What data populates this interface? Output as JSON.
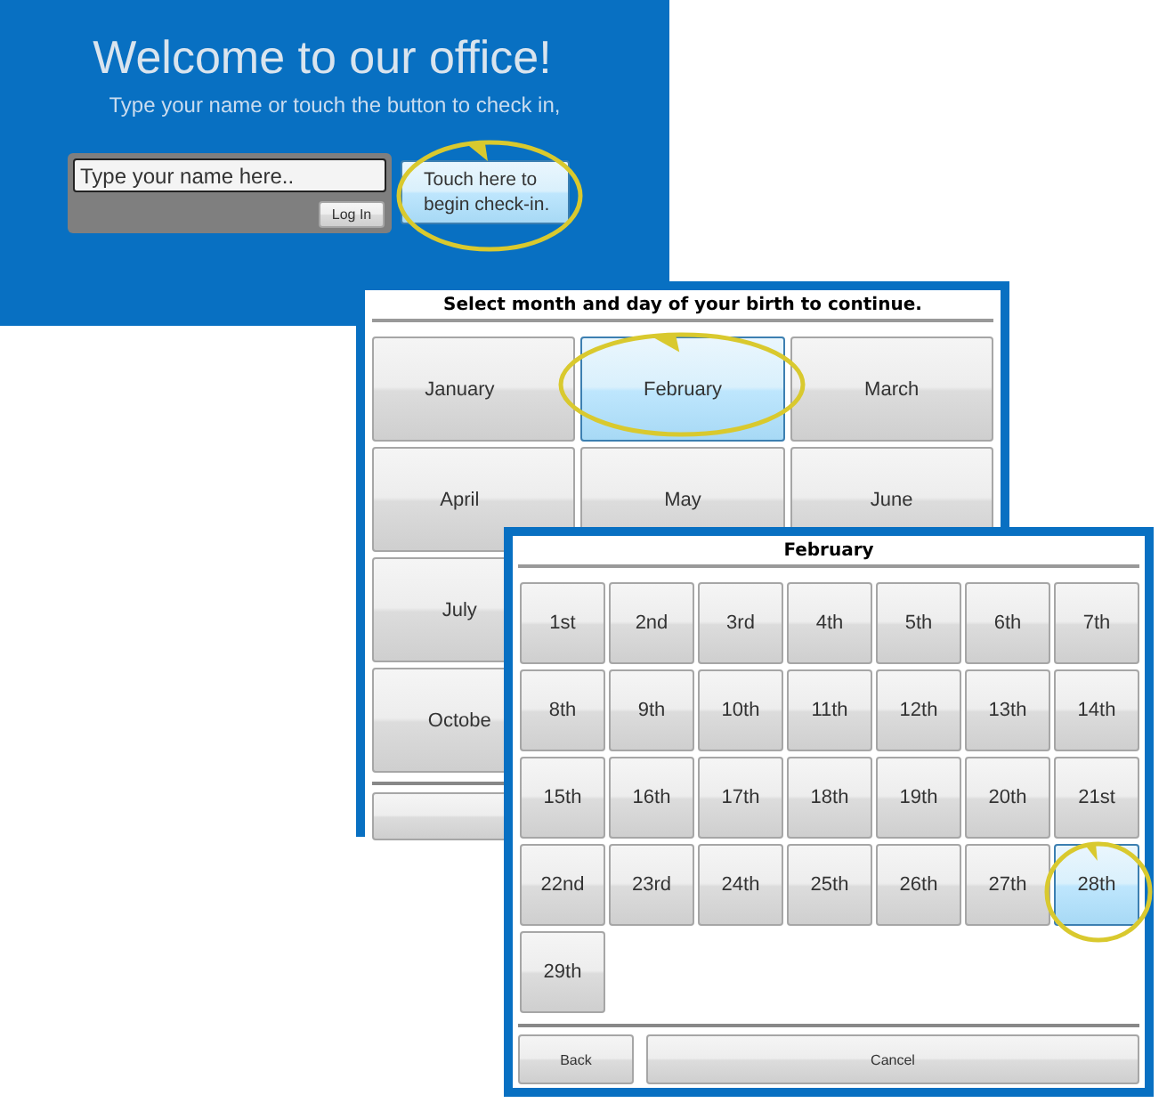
{
  "welcome": {
    "title": "Welcome to our office!",
    "subtitle": "Type your name or touch the button to check in,",
    "name_field": {
      "placeholder": "Type your name here.."
    },
    "login_button": "Log In",
    "checkin_button": "Touch here to begin check-in."
  },
  "month_dialog": {
    "title": "Select month and day of your birth to continue.",
    "rows": [
      [
        {
          "label": "January",
          "selected": false
        },
        {
          "label": "February",
          "selected": true
        },
        {
          "label": "March",
          "selected": false
        }
      ],
      [
        {
          "label": "April",
          "selected": false
        },
        {
          "label": "May",
          "selected": false
        },
        {
          "label": "June",
          "selected": false
        }
      ],
      [
        {
          "label": "July",
          "selected": false
        }
      ],
      [
        {
          "label": "Octobe",
          "selected": false
        }
      ]
    ]
  },
  "day_dialog": {
    "title": "February",
    "days": [
      {
        "label": "1st",
        "selected": false
      },
      {
        "label": "2nd",
        "selected": false
      },
      {
        "label": "3rd",
        "selected": false
      },
      {
        "label": "4th",
        "selected": false
      },
      {
        "label": "5th",
        "selected": false
      },
      {
        "label": "6th",
        "selected": false
      },
      {
        "label": "7th",
        "selected": false
      },
      {
        "label": "8th",
        "selected": false
      },
      {
        "label": "9th",
        "selected": false
      },
      {
        "label": "10th",
        "selected": false
      },
      {
        "label": "11th",
        "selected": false
      },
      {
        "label": "12th",
        "selected": false
      },
      {
        "label": "13th",
        "selected": false
      },
      {
        "label": "14th",
        "selected": false
      },
      {
        "label": "15th",
        "selected": false
      },
      {
        "label": "16th",
        "selected": false
      },
      {
        "label": "17th",
        "selected": false
      },
      {
        "label": "18th",
        "selected": false
      },
      {
        "label": "19th",
        "selected": false
      },
      {
        "label": "20th",
        "selected": false
      },
      {
        "label": "21st",
        "selected": false
      },
      {
        "label": "22nd",
        "selected": false
      },
      {
        "label": "23rd",
        "selected": false
      },
      {
        "label": "24th",
        "selected": false
      },
      {
        "label": "25th",
        "selected": false
      },
      {
        "label": "26th",
        "selected": false
      },
      {
        "label": "27th",
        "selected": false
      },
      {
        "label": "28th",
        "selected": true
      },
      {
        "label": "29th",
        "selected": false
      }
    ],
    "buttons": [
      "Back",
      "Cancel"
    ]
  }
}
